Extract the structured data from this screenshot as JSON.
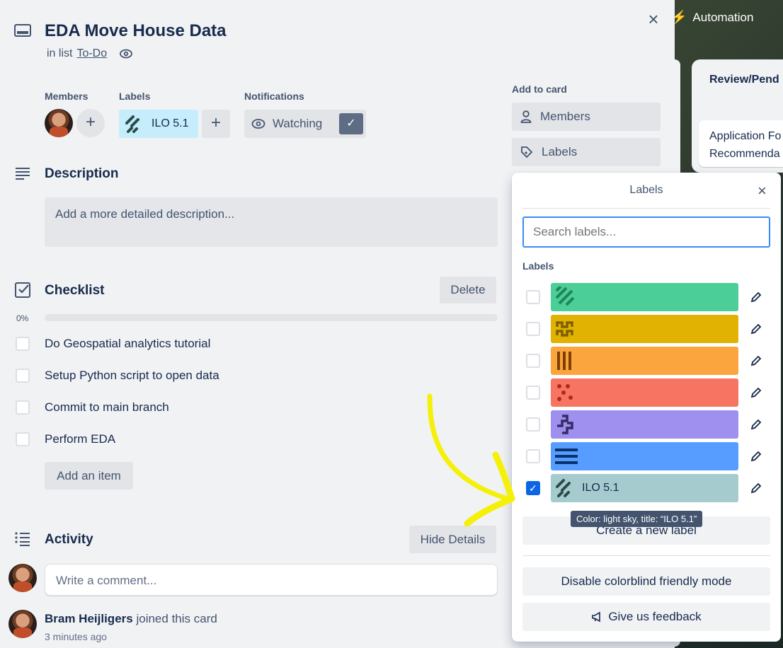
{
  "board": {
    "automation_label": "Automation",
    "list_title": "Review/Pend",
    "card_text": [
      "Application Fo",
      "Recommenda"
    ]
  },
  "card": {
    "title": "EDA Move House Data",
    "in_list_prefix": "in list",
    "list_name": "To-Do"
  },
  "sections": {
    "members_label": "Members",
    "labels_label": "Labels",
    "notifications_label": "Notifications",
    "watching_label": "Watching",
    "applied_label": "ILO 5.1"
  },
  "description": {
    "title": "Description",
    "placeholder": "Add a more detailed description..."
  },
  "checklist": {
    "title": "Checklist",
    "delete_label": "Delete",
    "percent_text": "0%",
    "progress": 0,
    "items": [
      {
        "text": "Do Geospatial analytics tutorial",
        "checked": false
      },
      {
        "text": "Setup Python script to open data",
        "checked": false
      },
      {
        "text": "Commit to main branch",
        "checked": false
      },
      {
        "text": "Perform EDA",
        "checked": false
      }
    ],
    "add_item_label": "Add an item"
  },
  "activity": {
    "title": "Activity",
    "hide_details_label": "Hide Details",
    "comment_placeholder": "Write a comment...",
    "entry_user": "Bram Heijligers",
    "entry_action": "joined this card",
    "entry_time": "3 minutes ago"
  },
  "sidebar": {
    "add_to_card_label": "Add to card",
    "members_button": "Members",
    "labels_button": "Labels"
  },
  "popover": {
    "title": "Labels",
    "search_placeholder": "Search labels...",
    "labels_heading": "Labels",
    "labels": [
      {
        "color": "#4bce97",
        "pattern": "diagonal",
        "pattern_color": "#1f845a",
        "title": "",
        "checked": false
      },
      {
        "color": "#e2b203",
        "pattern": "wave",
        "pattern_color": "#7f5f01",
        "title": "",
        "checked": false
      },
      {
        "color": "#faa53d",
        "pattern": "vertical",
        "pattern_color": "#7f3f00",
        "title": "",
        "checked": false
      },
      {
        "color": "#f87462",
        "pattern": "dots",
        "pattern_color": "#ae2a19",
        "title": "",
        "checked": false
      },
      {
        "color": "#9f8fef",
        "pattern": "zigzag",
        "pattern_color": "#352c63",
        "title": "",
        "checked": false
      },
      {
        "color": "#579dff",
        "pattern": "horizontal",
        "pattern_color": "#09326c",
        "title": "",
        "checked": false
      },
      {
        "color": "#a6cbce",
        "pattern": "slash",
        "pattern_color": "#2a4a4c",
        "title": "ILO 5.1",
        "checked": true
      }
    ],
    "tooltip": "Color: light sky, title: “ILO 5.1”",
    "create_label": "Create a new label",
    "colorblind_label": "Disable colorblind friendly mode",
    "feedback_label": "Give us feedback"
  },
  "colors": {
    "accent": "#0c66e4",
    "annotation_arrow": "#f5f007"
  }
}
